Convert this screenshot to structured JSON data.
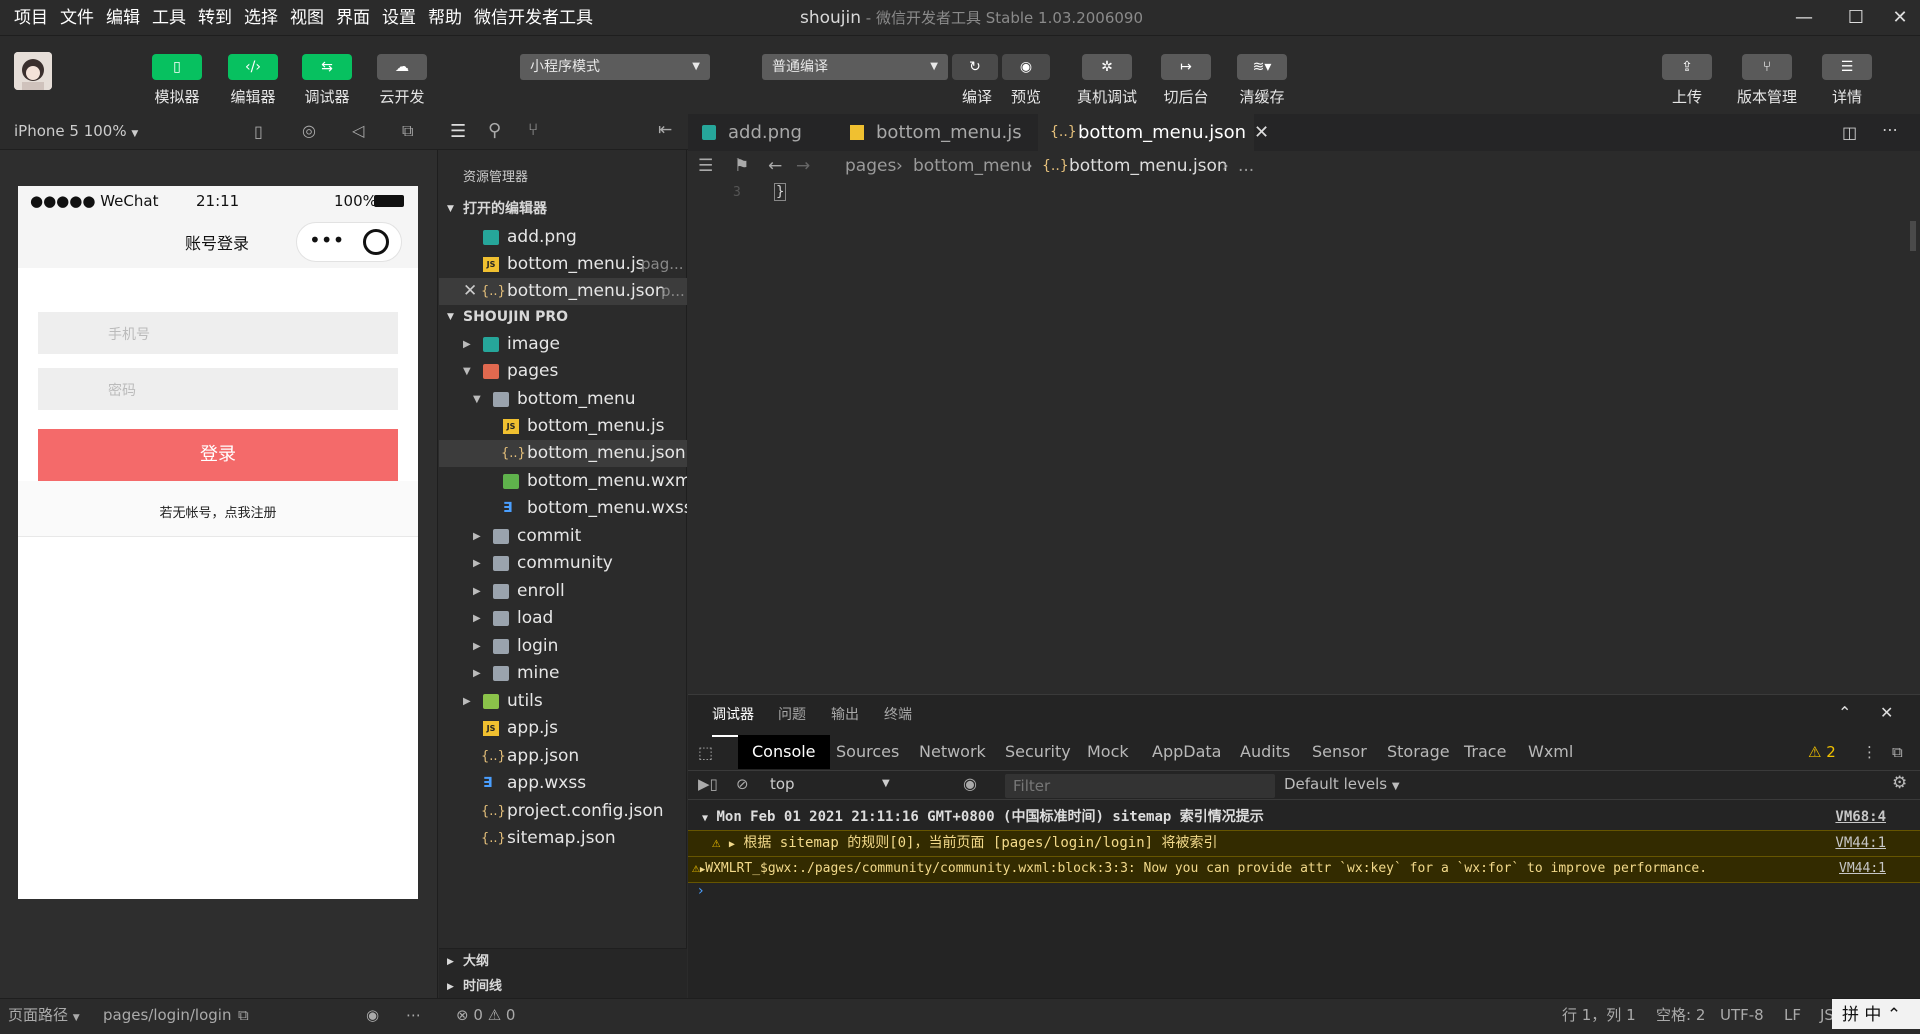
{
  "menubar": {
    "items": [
      "项目",
      "文件",
      "编辑",
      "工具",
      "转到",
      "选择",
      "视图",
      "界面",
      "设置",
      "帮助",
      "微信开发者工具"
    ],
    "title": "shoujin",
    "subtitle": " - 微信开发者工具 Stable 1.03.2006090"
  },
  "toolbar": {
    "simulator": "模拟器",
    "editor": "编辑器",
    "debugger": "调试器",
    "cloud": "云开发",
    "mode_select": "小程序模式",
    "compile_select": "普通编译",
    "compile": "编译",
    "preview": "预览",
    "real_debug": "真机调试",
    "backend": "切后台",
    "clear_cache": "清缓存",
    "upload": "上传",
    "version": "版本管理",
    "details": "详情"
  },
  "subbar": {
    "device": "iPhone 5 100%"
  },
  "phone": {
    "carrier": "●●●●● WeChat",
    "time": "21:11",
    "battery": "100%",
    "nav_title": "账号登录",
    "phone_placeholder": "手机号",
    "password_placeholder": "密码",
    "login_button": "登录",
    "register_link": "若无帐号，点我注册"
  },
  "explorer": {
    "title": "资源管理器",
    "open_editors": "打开的编辑器",
    "open_files": [
      {
        "name": "add.png",
        "hint": ""
      },
      {
        "name": "bottom_menu.js",
        "hint": "pag..."
      },
      {
        "name": "bottom_menu.json",
        "hint": "p..."
      }
    ],
    "project": "SHOUJIN PRO",
    "tree": {
      "image": "image",
      "pages": "pages",
      "bottom_menu": "bottom_menu",
      "bm_js": "bottom_menu.js",
      "bm_json": "bottom_menu.json",
      "bm_wxml": "bottom_menu.wxml",
      "bm_wxss": "bottom_menu.wxss",
      "commit": "commit",
      "community": "community",
      "enroll": "enroll",
      "load": "load",
      "login": "login",
      "mine": "mine",
      "utils": "utils",
      "app_js": "app.js",
      "app_json": "app.json",
      "app_wxss": "app.wxss",
      "project_config": "project.config.json",
      "sitemap": "sitemap.json"
    },
    "outline": "大纲",
    "timeline": "时间线"
  },
  "editor": {
    "tabs": [
      "add.png",
      "bottom_menu.js",
      "bottom_menu.json"
    ],
    "breadcrumb": [
      "pages",
      "bottom_menu",
      "bottom_menu.json",
      "..."
    ],
    "line_number": "3",
    "code": "}"
  },
  "devtools": {
    "top_tabs": [
      "调试器",
      "问题",
      "输出",
      "终端"
    ],
    "panel_tabs": [
      "Console",
      "Sources",
      "Network",
      "Security",
      "Mock",
      "AppData",
      "Audits",
      "Sensor",
      "Storage",
      "Trace",
      "Wxml"
    ],
    "warn_count": "2",
    "context": "top",
    "filter_placeholder": "Filter",
    "levels": "Default levels",
    "logs": [
      {
        "text": "Mon Feb 01 2021 21:11:16 GMT+0800 (中国标准时间) sitemap 索引情况提示",
        "src": "VM68:4"
      },
      {
        "text": "根据 sitemap 的规则[0]，当前页面 [pages/login/login] 将被索引",
        "src": "VM44:1"
      },
      {
        "text": "WXMLRT_$gwx:./pages/community/community.wxml:block:3:3: Now you can provide attr `wx:key` for a `wx:for` to improve performance.",
        "src": "VM44:1"
      }
    ]
  },
  "statusbar": {
    "page_path_label": "页面路径",
    "page_path": "pages/login/login",
    "errors": "0",
    "warnings": "0",
    "position": "行 1，列 1",
    "spaces": "空格: 2",
    "encoding": "UTF-8",
    "eol": "LF",
    "lang": "JS",
    "ime1": "拼",
    "ime2": "中"
  }
}
